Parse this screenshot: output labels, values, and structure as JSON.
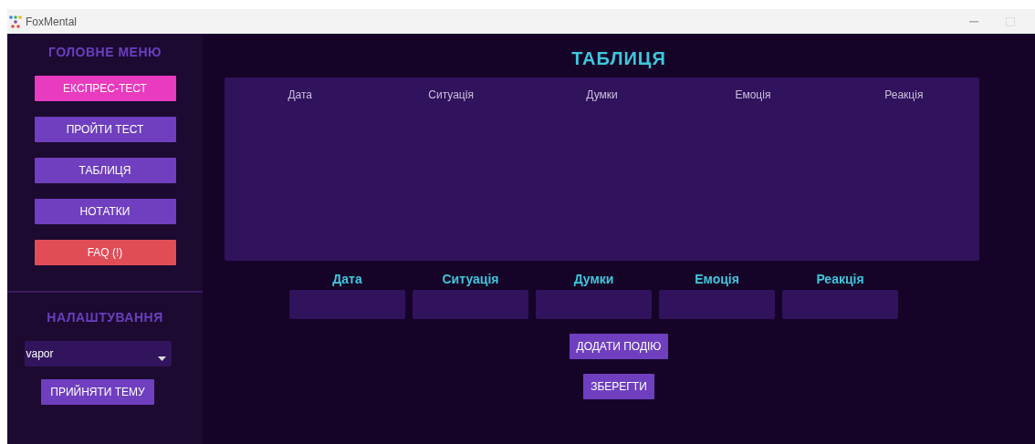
{
  "window": {
    "title": "FoxMental"
  },
  "sidebar": {
    "menu_heading": "ГОЛОВНЕ МЕНЮ",
    "menu_items": [
      {
        "label": "ЕКСПРЕС-ТЕСТ",
        "color": "#e83bbf"
      },
      {
        "label": "ПРОЙТИ ТЕСТ",
        "color": "#6f3fbf"
      },
      {
        "label": "ТАБЛИЦЯ",
        "color": "#6f3fbf"
      },
      {
        "label": "НОТАТКИ",
        "color": "#6f3fbf"
      },
      {
        "label": "FAQ (!)",
        "color": "#e04d57"
      }
    ],
    "settings_heading": "НАЛАШТУВАННЯ",
    "theme_select": {
      "value": "vapor"
    },
    "apply_button": "ПРИЙНЯТИ ТЕМУ"
  },
  "main": {
    "title": "ТАБЛИЦЯ",
    "table": {
      "columns": [
        "Дата",
        "Ситуація",
        "Думки",
        "Емоція",
        "Реакція"
      ]
    },
    "form": {
      "fields": [
        {
          "label": "Дата"
        },
        {
          "label": "Ситуація"
        },
        {
          "label": "Думки"
        },
        {
          "label": "Емоція"
        },
        {
          "label": "Реакція"
        }
      ]
    },
    "buttons": [
      "ДОДАТИ ПОДІЮ",
      "ЗБЕРЕГТИ"
    ]
  }
}
